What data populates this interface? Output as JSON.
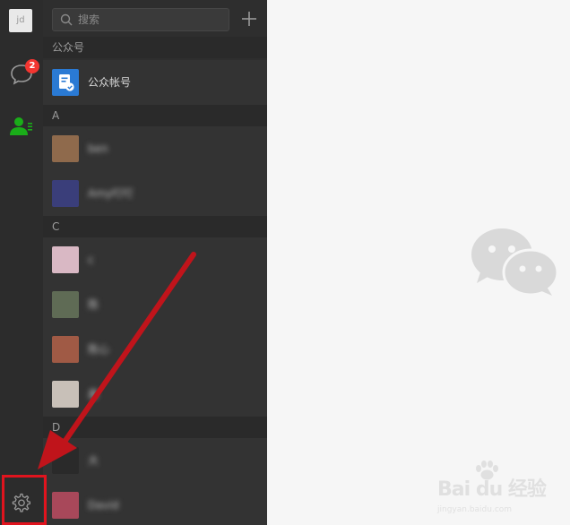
{
  "sidebar": {
    "me_avatar_text": "jd",
    "chat_badge": "2",
    "icons": [
      "chat-icon",
      "contacts-icon",
      "settings-icon"
    ]
  },
  "search": {
    "placeholder": "搜索"
  },
  "sections": {
    "official": "公众号",
    "a": "A",
    "c": "C",
    "d": "D"
  },
  "contacts": {
    "official_account": "公众帐号",
    "items": [
      {
        "name": "ben",
        "avatar_color": "#8f6a4c"
      },
      {
        "name": "Amy叮叮",
        "avatar_color": "#3a3e7a"
      },
      {
        "name": "c",
        "avatar_color": "#d9b8c4"
      },
      {
        "name": "陈",
        "avatar_color": "#5f6b55"
      },
      {
        "name": "陈心",
        "avatar_color": "#a05a45"
      },
      {
        "name": "晨",
        "avatar_color": "#c8c0b8"
      },
      {
        "name": "大",
        "avatar_color": "#2a2a2a"
      },
      {
        "name": "David",
        "avatar_color": "#a8485a"
      }
    ]
  },
  "colors": {
    "sidebar_bg": "#2c2c2c",
    "panel_bg": "#2e2e2e",
    "badge": "#f43530",
    "contacts_active": "#1aad19",
    "highlight": "#e0141e",
    "arrow": "#c0141b"
  },
  "watermark": {
    "brand": "Bai du 经验",
    "sub": "jingyan.baidu.com"
  }
}
